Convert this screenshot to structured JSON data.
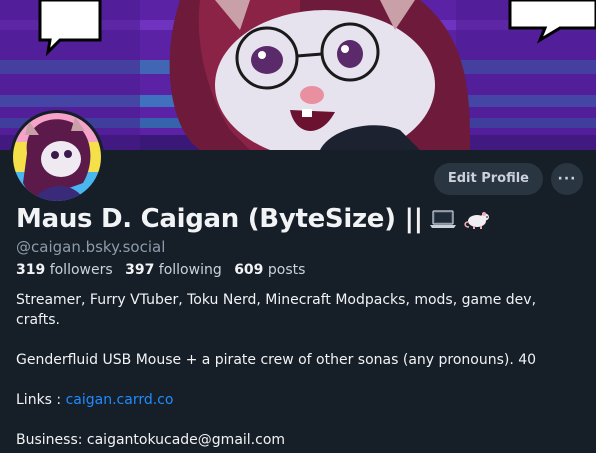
{
  "profile": {
    "display_name": "Maus D. Caigan (ByteSize) ||",
    "name_emojis": [
      "laptop-emoji",
      "rat-emoji"
    ],
    "handle": "@caigan.bsky.social",
    "followers_count": "319",
    "followers_label": "followers",
    "following_count": "397",
    "following_label": "following",
    "posts_count": "609",
    "posts_label": "posts"
  },
  "actions": {
    "edit_label": "Edit Profile",
    "more_label": "···"
  },
  "bio": {
    "line1": "Streamer, Furry VTuber, Toku Nerd, Minecraft Modpacks, mods, game dev, crafts.",
    "line2": "Genderfluid USB Mouse + a pirate crew of other sonas (any pronouns). 40",
    "links_label": "Links : ",
    "links_url": "caigan.carrd.co",
    "business": "Business: caigantokucade@gmail.com"
  },
  "colors": {
    "background": "#161e27",
    "button_bg": "#2a3542",
    "link": "#208bfe",
    "muted": "#8e9bab"
  }
}
